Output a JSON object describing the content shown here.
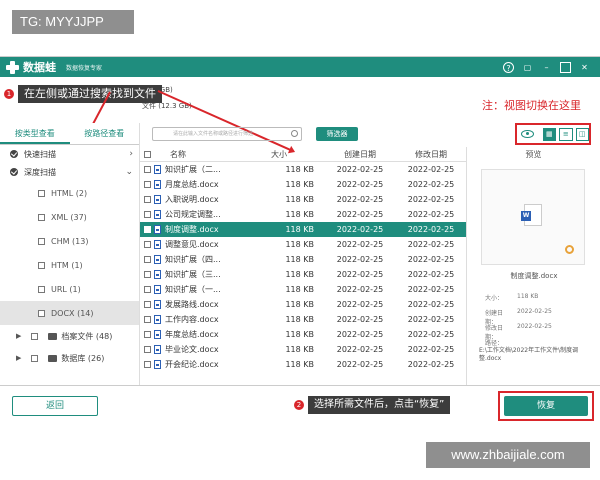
{
  "watermarks": {
    "top": "TG: MYYJJPP",
    "bottom": "www.zhbaijiale.com"
  },
  "titlebar": {
    "app_name": "数据蛙",
    "subtitle": "数据恢复专家"
  },
  "window_controls": [
    "?",
    "▢",
    "–",
    "□",
    "✕"
  ],
  "info": {
    "size1": "1.00 GB)",
    "size2": "文件 (12.3 GB)"
  },
  "callouts": {
    "left": "在左侧或通过搜索找到文件",
    "left_num": "1",
    "bottom": "选择所需文件后，点击“恢复”",
    "bottom_num": "2",
    "note": "注：视图切换在这里"
  },
  "sidebar": {
    "tabs": [
      "按类型查看",
      "按路径查看"
    ],
    "scans": [
      {
        "label": "快速扫描"
      },
      {
        "label": "深度扫描"
      }
    ],
    "types": [
      {
        "label": "HTML (2)"
      },
      {
        "label": "XML (37)"
      },
      {
        "label": "CHM (13)"
      },
      {
        "label": "HTM (1)"
      },
      {
        "label": "URL (1)"
      },
      {
        "label": "DOCX (14)"
      }
    ],
    "folders": [
      {
        "label": "档案文件 (48)"
      },
      {
        "label": "数据库 (26)"
      }
    ]
  },
  "search": {
    "placeholder": "请在此输入文件名称或路径进行筛选",
    "filter_label": "筛选器"
  },
  "view": {
    "list_icon": "≡",
    "grid_icon": "▦",
    "detail_icon": "◫"
  },
  "table": {
    "headers": {
      "name": "名称",
      "size": "大小",
      "created": "创建日期",
      "modified": "修改日期"
    },
    "rows": [
      {
        "name": "知识扩展（二...",
        "size": "118 KB",
        "created": "2022-02-25",
        "modified": "2022-02-25"
      },
      {
        "name": "月度总结.docx",
        "size": "118 KB",
        "created": "2022-02-25",
        "modified": "2022-02-25"
      },
      {
        "name": "入职说明.docx",
        "size": "118 KB",
        "created": "2022-02-25",
        "modified": "2022-02-25"
      },
      {
        "name": "公司规定调整...",
        "size": "118 KB",
        "created": "2022-02-25",
        "modified": "2022-02-25"
      },
      {
        "name": "制度调整.docx",
        "size": "118 KB",
        "created": "2022-02-25",
        "modified": "2022-02-25"
      },
      {
        "name": "调整意见.docx",
        "size": "118 KB",
        "created": "2022-02-25",
        "modified": "2022-02-25"
      },
      {
        "name": "知识扩展（四...",
        "size": "118 KB",
        "created": "2022-02-25",
        "modified": "2022-02-25"
      },
      {
        "name": "知识扩展（三...",
        "size": "118 KB",
        "created": "2022-02-25",
        "modified": "2022-02-25"
      },
      {
        "name": "知识扩展（一...",
        "size": "118 KB",
        "created": "2022-02-25",
        "modified": "2022-02-25"
      },
      {
        "name": "发展路线.docx",
        "size": "118 KB",
        "created": "2022-02-25",
        "modified": "2022-02-25"
      },
      {
        "name": "工作内容.docx",
        "size": "118 KB",
        "created": "2022-02-25",
        "modified": "2022-02-25"
      },
      {
        "name": "年度总结.docx",
        "size": "118 KB",
        "created": "2022-02-25",
        "modified": "2022-02-25"
      },
      {
        "name": "毕业论文.docx",
        "size": "118 KB",
        "created": "2022-02-25",
        "modified": "2022-02-25"
      },
      {
        "name": "开会纪论.docx",
        "size": "118 KB",
        "created": "2022-02-25",
        "modified": "2022-02-25"
      }
    ]
  },
  "preview": {
    "title": "预览",
    "file_name": "制度调整.docx",
    "size_label": "大小：",
    "size_value": "118 KB",
    "created_label": "创建日期：",
    "created_value": "2022-02-25",
    "modified_label": "修改日期：",
    "modified_value": "2022-02-25",
    "path_label": "路径：",
    "path_value": "E:\\工作文档\\2022年工作文件\\制度调整.docx"
  },
  "buttons": {
    "back": "返回",
    "recover": "恢复"
  },
  "colors": {
    "accent": "#1f8d7e",
    "highlight": "#d9262b"
  }
}
